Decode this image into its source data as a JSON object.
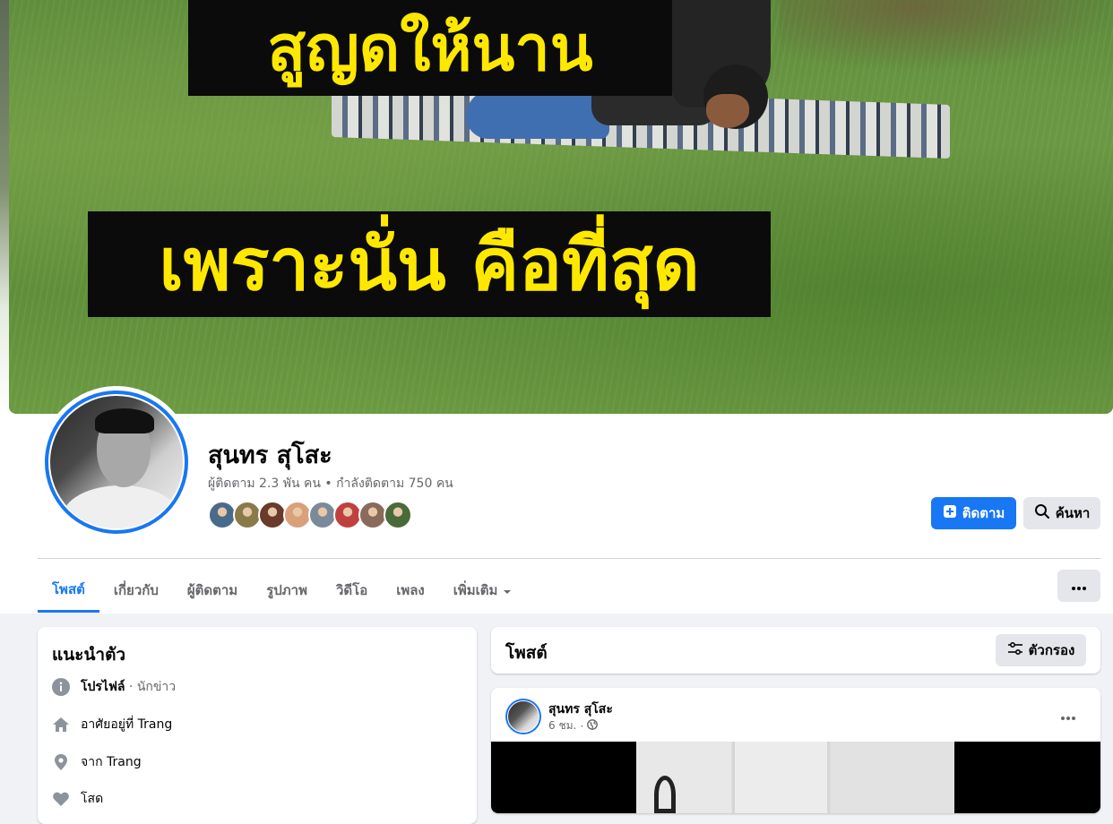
{
  "cover": {
    "caption_top": "สูญดให้นาน",
    "caption_bottom": "เพราะนั่น คือที่สุด"
  },
  "profile": {
    "name": "สุนทร สุโสะ",
    "stats": "ผู้ติดตาม 2.3 พัน คน • กำลังติดตาม 750 คน",
    "follower_avatar_colors": [
      "#4a6a8a",
      "#8a7a4a",
      "#6a3a2a",
      "#d9a07a",
      "#7a8a9a",
      "#c04040",
      "#8a6a5a",
      "#4a6a3a"
    ]
  },
  "actions": {
    "follow_label": "ติดตาม",
    "search_label": "ค้นหา"
  },
  "tabs": [
    {
      "label": "โพสต์",
      "active": true
    },
    {
      "label": "เกี่ยวกับ"
    },
    {
      "label": "ผู้ติดตาม"
    },
    {
      "label": "รูปภาพ"
    },
    {
      "label": "วิดีโอ"
    },
    {
      "label": "เพลง"
    },
    {
      "label": "เพิ่มเติม"
    }
  ],
  "intro": {
    "title": "แนะนำตัว",
    "profile_label": "โปรไฟล์",
    "profile_type": " · นักข่าว",
    "lives_in": "อาศัยอยู่ที่ Trang",
    "from_prefix": "จาก",
    "from_place": "Trang",
    "relationship": "โสด"
  },
  "posts_header": {
    "title": "โพสต์",
    "filter_label": "ตัวกรอง"
  },
  "post": {
    "author": "สุนทร สุโสะ",
    "time": "6 ชม.",
    "separator": "·"
  },
  "colors": {
    "accent": "#1877f2",
    "secondary_button": "#e4e6eb",
    "page_background": "#f0f2f5",
    "muted_text": "#65676b",
    "caption_text": "#ffe800",
    "caption_background": "#0b0b0b"
  }
}
